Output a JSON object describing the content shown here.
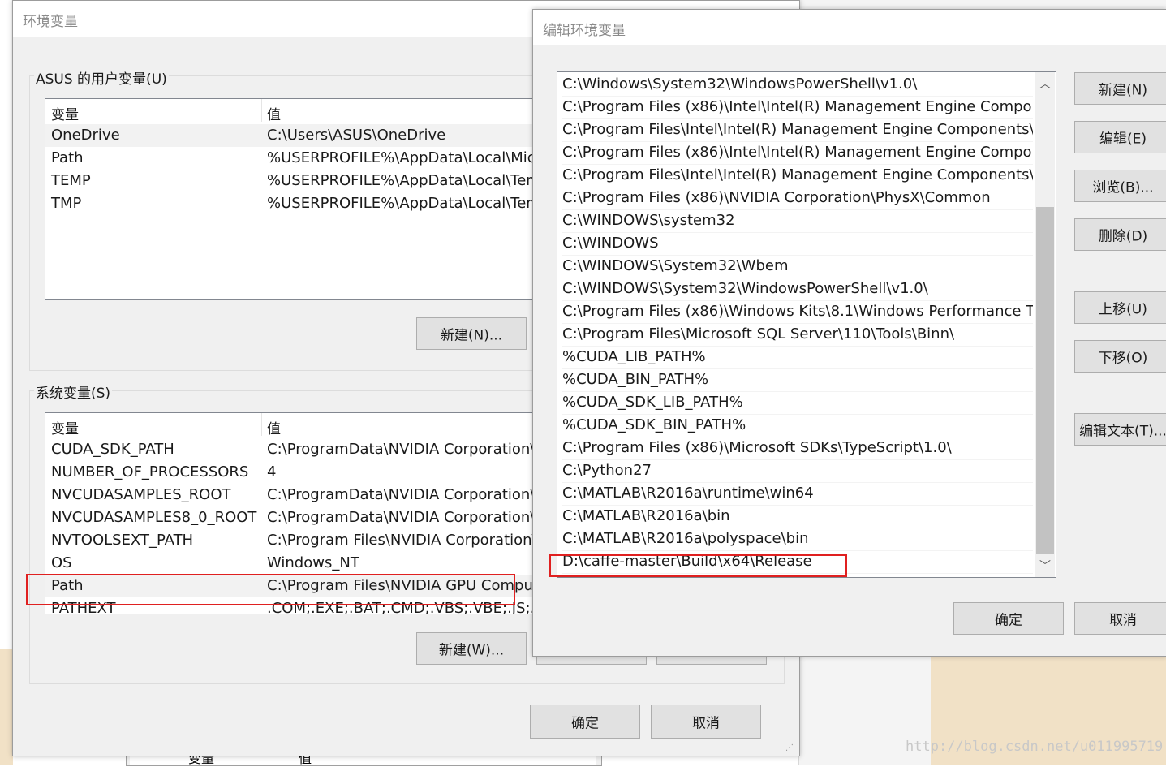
{
  "env_dialog": {
    "title": "环境变量",
    "user_group_label": "ASUS 的用户变量(U)",
    "columns": [
      "变量",
      "值"
    ],
    "user_vars": [
      {
        "name": "OneDrive",
        "value": "C:\\Users\\ASUS\\OneDrive"
      },
      {
        "name": "Path",
        "value": "%USERPROFILE%\\AppData\\Local\\Micr"
      },
      {
        "name": "TEMP",
        "value": "%USERPROFILE%\\AppData\\Local\\Tem"
      },
      {
        "name": "TMP",
        "value": "%USERPROFILE%\\AppData\\Local\\Tem"
      }
    ],
    "user_new_button": "新建(N)...",
    "system_group_label": "系统变量(S)",
    "system_vars": [
      {
        "name": "CUDA_SDK_PATH",
        "value": "C:\\ProgramData\\NVIDIA Corporation\\"
      },
      {
        "name": "NUMBER_OF_PROCESSORS",
        "value": "4"
      },
      {
        "name": "NVCUDASAMPLES_ROOT",
        "value": "C:\\ProgramData\\NVIDIA Corporation\\"
      },
      {
        "name": "NVCUDASAMPLES8_0_ROOT",
        "value": "C:\\ProgramData\\NVIDIA Corporation\\"
      },
      {
        "name": "NVTOOLSEXT_PATH",
        "value": "C:\\Program Files\\NVIDIA Corporation\\"
      },
      {
        "name": "OS",
        "value": "Windows_NT"
      },
      {
        "name": "Path",
        "value": "C:\\Program Files\\NVIDIA GPU Comput"
      },
      {
        "name": "PATHEXT",
        "value": ".COM;.EXE;.BAT;.CMD;.VBS;.VBE;.JS;.JSE"
      }
    ],
    "system_new_button": "新建(W)...",
    "ok_button": "确定",
    "cancel_button": "取消"
  },
  "edit_dialog": {
    "title": "编辑环境变量",
    "paths": [
      "C:\\Windows\\System32\\WindowsPowerShell\\v1.0\\",
      "C:\\Program Files (x86)\\Intel\\Intel(R) Management Engine Compo...",
      "C:\\Program Files\\Intel\\Intel(R) Management Engine Components\\...",
      "C:\\Program Files (x86)\\Intel\\Intel(R) Management Engine Compo...",
      "C:\\Program Files\\Intel\\Intel(R) Management Engine Components\\...",
      "C:\\Program Files (x86)\\NVIDIA Corporation\\PhysX\\Common",
      "C:\\WINDOWS\\system32",
      "C:\\WINDOWS",
      "C:\\WINDOWS\\System32\\Wbem",
      "C:\\WINDOWS\\System32\\WindowsPowerShell\\v1.0\\",
      "C:\\Program Files (x86)\\Windows Kits\\8.1\\Windows Performance T...",
      "C:\\Program Files\\Microsoft SQL Server\\110\\Tools\\Binn\\",
      "%CUDA_LIB_PATH%",
      "%CUDA_BIN_PATH%",
      "%CUDA_SDK_LIB_PATH%",
      "%CUDA_SDK_BIN_PATH%",
      "C:\\Program Files (x86)\\Microsoft SDKs\\TypeScript\\1.0\\",
      "C:\\Python27",
      "C:\\MATLAB\\R2016a\\runtime\\win64",
      "C:\\MATLAB\\R2016a\\bin",
      "C:\\MATLAB\\R2016a\\polyspace\\bin",
      "D:\\caffe-master\\Build\\x64\\Release"
    ],
    "buttons": {
      "new": "新建(N)",
      "edit": "编辑(E)",
      "browse": "浏览(B)...",
      "delete": "删除(D)",
      "move_up": "上移(U)",
      "move_down": "下移(O)",
      "edit_text": "编辑文本(T)..."
    },
    "ok_button": "确定",
    "cancel_button": "取消"
  },
  "background": {
    "bottom_columns": [
      "变量",
      "值"
    ]
  },
  "watermark": "http://blog.csdn.net/u011995719",
  "colors": {
    "highlight": "#e02020",
    "dialog_bg": "#f0f0f0",
    "button_bg": "#e1e1e1"
  }
}
